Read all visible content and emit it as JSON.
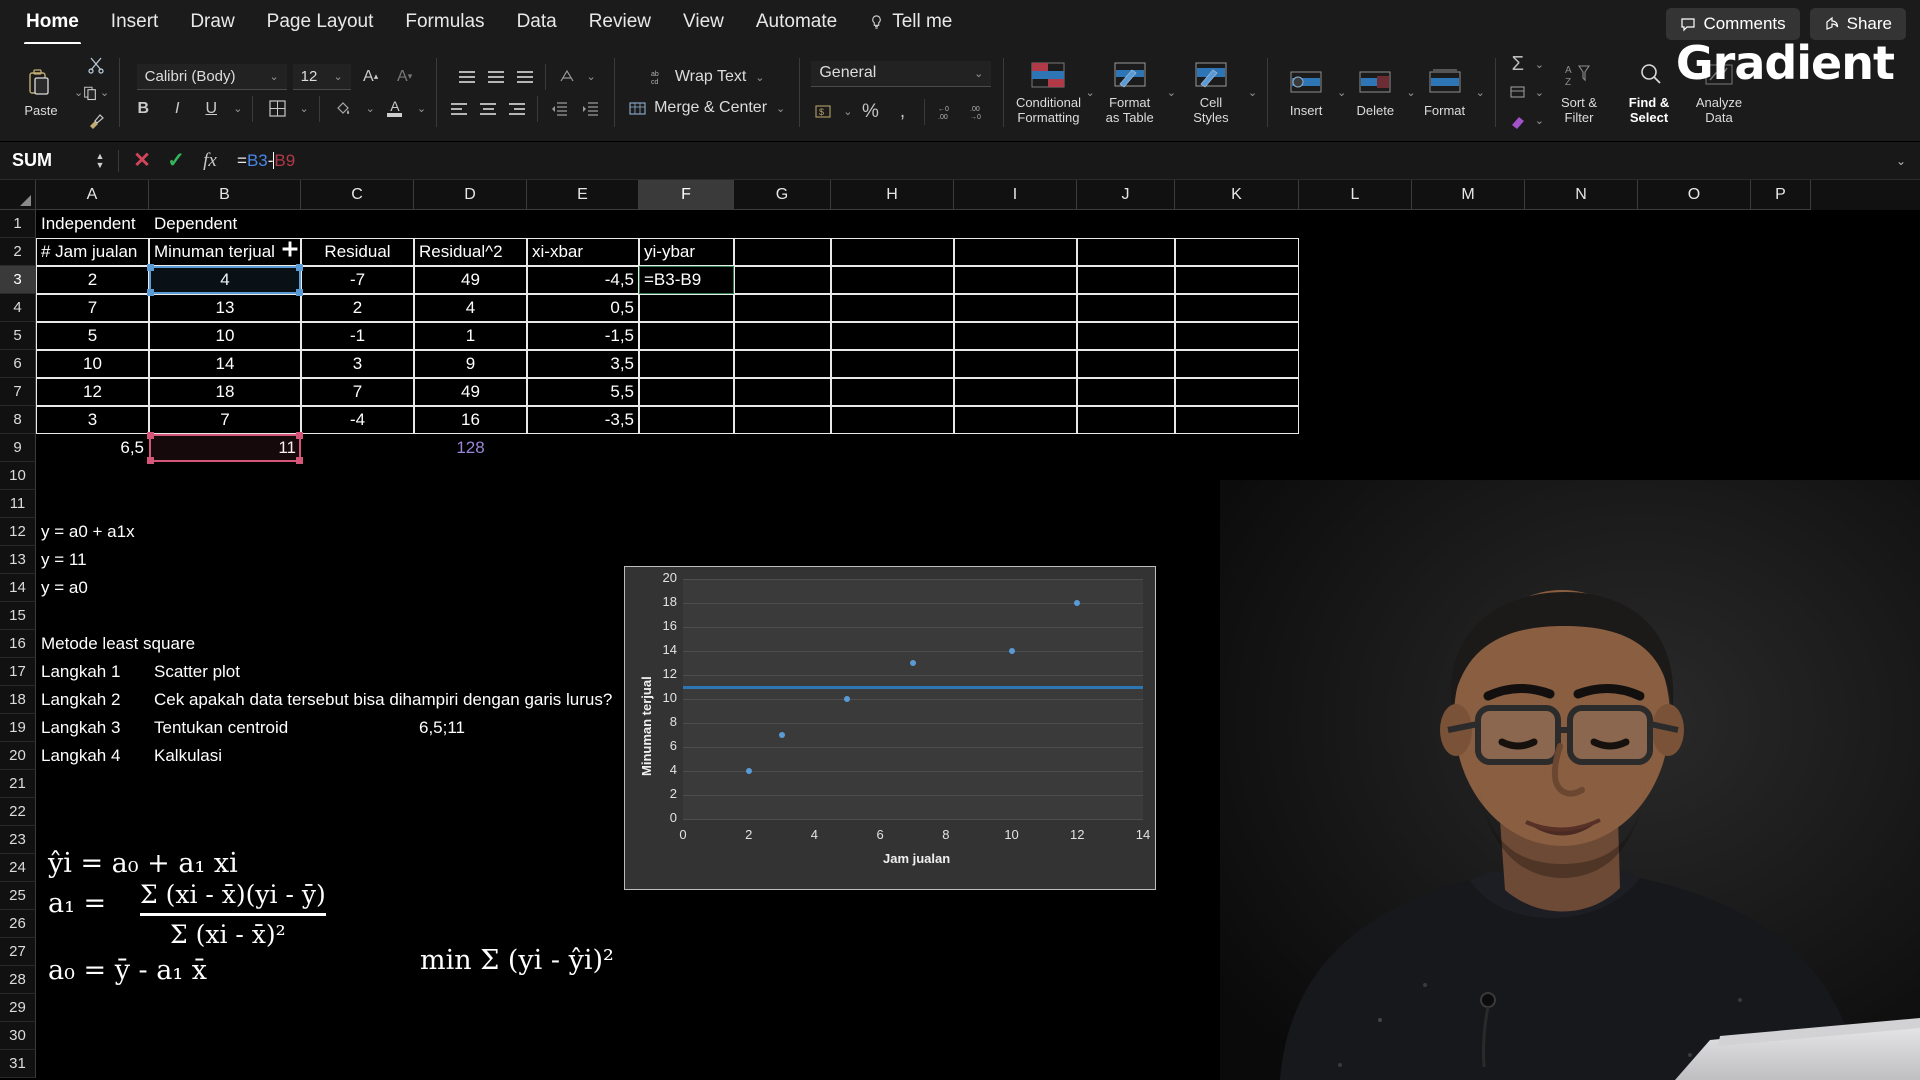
{
  "menu": {
    "items": [
      {
        "label": "Home",
        "active": true
      },
      {
        "label": "Insert",
        "active": false
      },
      {
        "label": "Draw",
        "active": false
      },
      {
        "label": "Page Layout",
        "active": false
      },
      {
        "label": "Formulas",
        "active": false
      },
      {
        "label": "Data",
        "active": false
      },
      {
        "label": "Review",
        "active": false
      },
      {
        "label": "View",
        "active": false
      },
      {
        "label": "Automate",
        "active": false
      }
    ],
    "tell_me": "Tell me",
    "comments": "Comments",
    "share": "Share"
  },
  "brand": {
    "logo_text": "Gradient"
  },
  "ribbon": {
    "paste_label": "Paste",
    "font_name": "Calibri (Body)",
    "font_size": "12",
    "wrap_text": "Wrap Text",
    "merge_center": "Merge & Center",
    "number_format": "General",
    "conditional_formatting": "Conditional\nFormatting",
    "conditional_formatting_l1": "Conditional",
    "conditional_formatting_l2": "Formatting",
    "format_as_table_l1": "Format",
    "format_as_table_l2": "as Table",
    "cell_styles_l1": "Cell",
    "cell_styles_l2": "Styles",
    "insert": "Insert",
    "delete": "Delete",
    "format": "Format",
    "sort_filter_l1": "Sort &",
    "sort_filter_l2": "Filter",
    "find_select_l1": "Find &",
    "find_select_l2": "Select",
    "analyze_data_l1": "Analyze",
    "analyze_data_l2": "Data"
  },
  "formula_bar": {
    "name_box": "SUM",
    "cancel_icon": "✕",
    "confirm_icon": "✓",
    "fx_icon": "fx",
    "formula_prefix": "=",
    "ref1": "B3",
    "operator": "-",
    "ref2": "B9"
  },
  "grid": {
    "columns": [
      "A",
      "B",
      "C",
      "D",
      "E",
      "F",
      "G",
      "H",
      "I",
      "J",
      "K",
      "L",
      "M",
      "N",
      "O",
      "P"
    ],
    "selected_column": "F",
    "row_numbers": [
      "1",
      "2",
      "3",
      "4",
      "5",
      "6",
      "7",
      "8",
      "9",
      "10",
      "11",
      "12",
      "13",
      "14",
      "15",
      "16",
      "17",
      "18",
      "19",
      "20",
      "21",
      "22",
      "23",
      "24",
      "25",
      "26",
      "27",
      "28",
      "29",
      "30",
      "31"
    ],
    "selected_row": "3",
    "rows": [
      {
        "n": "1",
        "cells": [
          {
            "col": "A",
            "v": "Independent",
            "align": "l"
          },
          {
            "col": "B",
            "v": "Dependent",
            "align": "l"
          }
        ]
      },
      {
        "n": "2",
        "cells": [
          {
            "col": "A",
            "v": "# Jam jualan",
            "align": "l"
          },
          {
            "col": "B",
            "v": "Minuman terjual",
            "align": "l"
          },
          {
            "col": "C",
            "v": "Residual",
            "align": "c"
          },
          {
            "col": "D",
            "v": "Residual^2",
            "align": "l"
          },
          {
            "col": "E",
            "v": "xi-xbar",
            "align": "l"
          },
          {
            "col": "F",
            "v": "yi-ybar",
            "align": "l"
          }
        ]
      },
      {
        "n": "3",
        "cells": [
          {
            "col": "A",
            "v": "2",
            "align": "c"
          },
          {
            "col": "B",
            "v": "4",
            "align": "c"
          },
          {
            "col": "C",
            "v": "-7",
            "align": "c"
          },
          {
            "col": "D",
            "v": "49",
            "align": "c"
          },
          {
            "col": "E",
            "v": "-4,5",
            "align": "r"
          },
          {
            "col": "F",
            "v": "=B3-B9",
            "align": "l"
          }
        ]
      },
      {
        "n": "4",
        "cells": [
          {
            "col": "A",
            "v": "7",
            "align": "c"
          },
          {
            "col": "B",
            "v": "13",
            "align": "c"
          },
          {
            "col": "C",
            "v": "2",
            "align": "c"
          },
          {
            "col": "D",
            "v": "4",
            "align": "c"
          },
          {
            "col": "E",
            "v": "0,5",
            "align": "r"
          }
        ]
      },
      {
        "n": "5",
        "cells": [
          {
            "col": "A",
            "v": "5",
            "align": "c"
          },
          {
            "col": "B",
            "v": "10",
            "align": "c"
          },
          {
            "col": "C",
            "v": "-1",
            "align": "c"
          },
          {
            "col": "D",
            "v": "1",
            "align": "c"
          },
          {
            "col": "E",
            "v": "-1,5",
            "align": "r"
          }
        ]
      },
      {
        "n": "6",
        "cells": [
          {
            "col": "A",
            "v": "10",
            "align": "c"
          },
          {
            "col": "B",
            "v": "14",
            "align": "c"
          },
          {
            "col": "C",
            "v": "3",
            "align": "c"
          },
          {
            "col": "D",
            "v": "9",
            "align": "c"
          },
          {
            "col": "E",
            "v": "3,5",
            "align": "r"
          }
        ]
      },
      {
        "n": "7",
        "cells": [
          {
            "col": "A",
            "v": "12",
            "align": "c"
          },
          {
            "col": "B",
            "v": "18",
            "align": "c"
          },
          {
            "col": "C",
            "v": "7",
            "align": "c"
          },
          {
            "col": "D",
            "v": "49",
            "align": "c"
          },
          {
            "col": "E",
            "v": "5,5",
            "align": "r"
          }
        ]
      },
      {
        "n": "8",
        "cells": [
          {
            "col": "A",
            "v": "3",
            "align": "c"
          },
          {
            "col": "B",
            "v": "7",
            "align": "c"
          },
          {
            "col": "C",
            "v": "-4",
            "align": "c"
          },
          {
            "col": "D",
            "v": "16",
            "align": "c"
          },
          {
            "col": "E",
            "v": "-3,5",
            "align": "r"
          }
        ]
      },
      {
        "n": "9",
        "cells": [
          {
            "col": "A",
            "v": "6,5",
            "align": "r"
          },
          {
            "col": "B",
            "v": "11",
            "align": "r"
          },
          {
            "col": "D",
            "v": "128",
            "align": "c",
            "style": "purple"
          }
        ]
      },
      {
        "n": "12",
        "cells": [
          {
            "col": "A",
            "v": "y = a0 + a1x",
            "align": "l"
          }
        ]
      },
      {
        "n": "13",
        "cells": [
          {
            "col": "A",
            "v": "y = 11",
            "align": "l"
          }
        ]
      },
      {
        "n": "14",
        "cells": [
          {
            "col": "A",
            "v": "y = a0",
            "align": "l"
          }
        ]
      },
      {
        "n": "16",
        "cells": [
          {
            "col": "A",
            "v": "Metode least square",
            "align": "l"
          }
        ]
      },
      {
        "n": "17",
        "cells": [
          {
            "col": "A",
            "v": "Langkah 1",
            "align": "l"
          },
          {
            "col": "B",
            "v": "Scatter plot",
            "align": "l"
          }
        ]
      },
      {
        "n": "18",
        "cells": [
          {
            "col": "A",
            "v": "Langkah 2",
            "align": "l"
          },
          {
            "col": "B",
            "v": "Cek apakah data tersebut bisa dihampiri dengan garis lurus?",
            "align": "l"
          }
        ]
      },
      {
        "n": "19",
        "cells": [
          {
            "col": "A",
            "v": "Langkah 3",
            "align": "l"
          },
          {
            "col": "B",
            "v": "Tentukan centroid",
            "align": "l"
          },
          {
            "col": "D",
            "v": "6,5;11",
            "align": "l"
          }
        ]
      },
      {
        "n": "20",
        "cells": [
          {
            "col": "A",
            "v": "Langkah 4",
            "align": "l"
          },
          {
            "col": "B",
            "v": "Kalkulasi",
            "align": "l"
          }
        ]
      }
    ]
  },
  "handwriting": {
    "line1": "ŷi = a₀ + a₁ xi",
    "line2_lhs": "a₁  =",
    "line2_num": "Σ (xi - x̄)(yi - ȳ)",
    "line2_den": "Σ (xi - x̄)²",
    "line3": "a₀ = ȳ - a₁ x̄",
    "line4": "min Σ (yi - ŷi)²"
  },
  "chart_data": {
    "type": "scatter",
    "title": "",
    "xlabel": "Jam jualan",
    "ylabel": "Minuman terjual",
    "x": [
      2,
      7,
      5,
      10,
      12,
      3
    ],
    "y": [
      4,
      13,
      10,
      14,
      18,
      7
    ],
    "xlim": [
      0,
      14
    ],
    "ylim": [
      0,
      20
    ],
    "xticks": [
      0,
      2,
      4,
      6,
      8,
      10,
      12,
      14
    ],
    "yticks": [
      0,
      2,
      4,
      6,
      8,
      10,
      12,
      14,
      16,
      18,
      20
    ],
    "grid": true,
    "legend": "none",
    "series": [
      {
        "name": "Minuman terjual",
        "type": "scatter",
        "color": "#5b9bd5",
        "points": [
          [
            2,
            4
          ],
          [
            7,
            13
          ],
          [
            5,
            10
          ],
          [
            10,
            14
          ],
          [
            12,
            18
          ],
          [
            3,
            7
          ]
        ]
      },
      {
        "name": "y = 11",
        "type": "line",
        "color": "#2e75b6",
        "points": [
          [
            0,
            11
          ],
          [
            14,
            11
          ]
        ]
      }
    ]
  }
}
